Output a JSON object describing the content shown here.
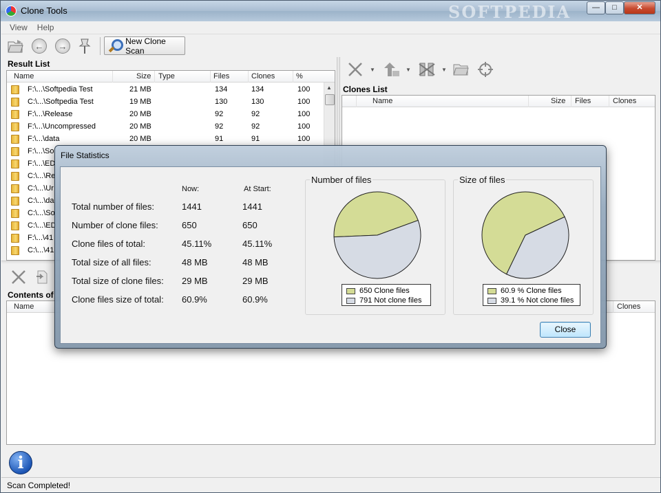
{
  "window": {
    "title": "Clone Tools",
    "watermark": "SOFTPEDIA",
    "min_glyph": "—",
    "max_glyph": "□",
    "close_glyph": "✕"
  },
  "menu": {
    "view": "View",
    "help": "Help"
  },
  "toolbar": {
    "new_clone_scan": "New Clone Scan"
  },
  "result_list": {
    "label": "Result List",
    "headers": {
      "name": "Name",
      "size": "Size",
      "type": "Type",
      "files": "Files",
      "clones": "Clones",
      "pct": "%"
    },
    "rows": [
      {
        "name": "F:\\...\\Softpedia Test",
        "size": "21 MB",
        "type": "",
        "files": "134",
        "clones": "134",
        "pct": "100"
      },
      {
        "name": "C:\\...\\Softpedia Test",
        "size": "19 MB",
        "type": "",
        "files": "130",
        "clones": "130",
        "pct": "100"
      },
      {
        "name": "F:\\...\\Release",
        "size": "20 MB",
        "type": "",
        "files": "92",
        "clones": "92",
        "pct": "100"
      },
      {
        "name": "F:\\...\\Uncompressed",
        "size": "20 MB",
        "type": "",
        "files": "92",
        "clones": "92",
        "pct": "100"
      },
      {
        "name": "F:\\...\\data",
        "size": "20 MB",
        "type": "",
        "files": "91",
        "clones": "91",
        "pct": "100"
      },
      {
        "name": "F:\\...\\So",
        "size": "",
        "type": "",
        "files": "",
        "clones": "",
        "pct": ""
      },
      {
        "name": "F:\\...\\ED",
        "size": "",
        "type": "",
        "files": "",
        "clones": "",
        "pct": ""
      },
      {
        "name": "C:\\...\\Re",
        "size": "",
        "type": "",
        "files": "",
        "clones": "",
        "pct": ""
      },
      {
        "name": "C:\\...\\Ur",
        "size": "",
        "type": "",
        "files": "",
        "clones": "",
        "pct": ""
      },
      {
        "name": "C:\\...\\da",
        "size": "",
        "type": "",
        "files": "",
        "clones": "",
        "pct": ""
      },
      {
        "name": "C:\\...\\So",
        "size": "",
        "type": "",
        "files": "",
        "clones": "",
        "pct": ""
      },
      {
        "name": "C:\\...\\ED",
        "size": "",
        "type": "",
        "files": "",
        "clones": "",
        "pct": ""
      },
      {
        "name": "F:\\...\\41",
        "size": "",
        "type": "",
        "files": "",
        "clones": "",
        "pct": ""
      },
      {
        "name": "C:\\...\\41",
        "size": "",
        "type": "",
        "files": "",
        "clones": "",
        "pct": ""
      }
    ]
  },
  "clones_list": {
    "label": "Clones List",
    "headers": {
      "name": "Name",
      "size": "Size",
      "files": "Files",
      "clones": "Clones"
    }
  },
  "contents": {
    "label": "Contents of",
    "headers": {
      "name": "Name",
      "clones": "Clones"
    }
  },
  "status": {
    "text": "Scan Completed!",
    "info_glyph": "i"
  },
  "dialog": {
    "title": "File Statistics",
    "col_now": "Now:",
    "col_start": "At Start:",
    "stats": [
      {
        "label": "Total number of files:",
        "now": "1441",
        "start": "1441"
      },
      {
        "label": "Number of clone files:",
        "now": "650",
        "start": "650"
      },
      {
        "label": "Clone files of total:",
        "now": "45.11%",
        "start": "45.11%"
      },
      {
        "label": "Total size of all files:",
        "now": "48 MB",
        "start": "48 MB"
      },
      {
        "label": "Total size of clone files:",
        "now": "29 MB",
        "start": "29 MB"
      },
      {
        "label": "Clone files size of total:",
        "now": "60.9%",
        "start": "60.9%"
      }
    ],
    "close_label": "Close",
    "colors": {
      "clone": "#d4dc96",
      "not_clone": "#d6dbe4"
    }
  },
  "chart_data": [
    {
      "type": "pie",
      "title": "Number of files",
      "series": [
        {
          "name": "650 Clone files",
          "value": 650
        },
        {
          "name": "791 Not clone files",
          "value": 791
        }
      ]
    },
    {
      "type": "pie",
      "title": "Size of files",
      "series": [
        {
          "name": "60.9 % Clone files",
          "value": 60.9
        },
        {
          "name": "39.1 % Not clone files",
          "value": 39.1
        }
      ]
    }
  ]
}
